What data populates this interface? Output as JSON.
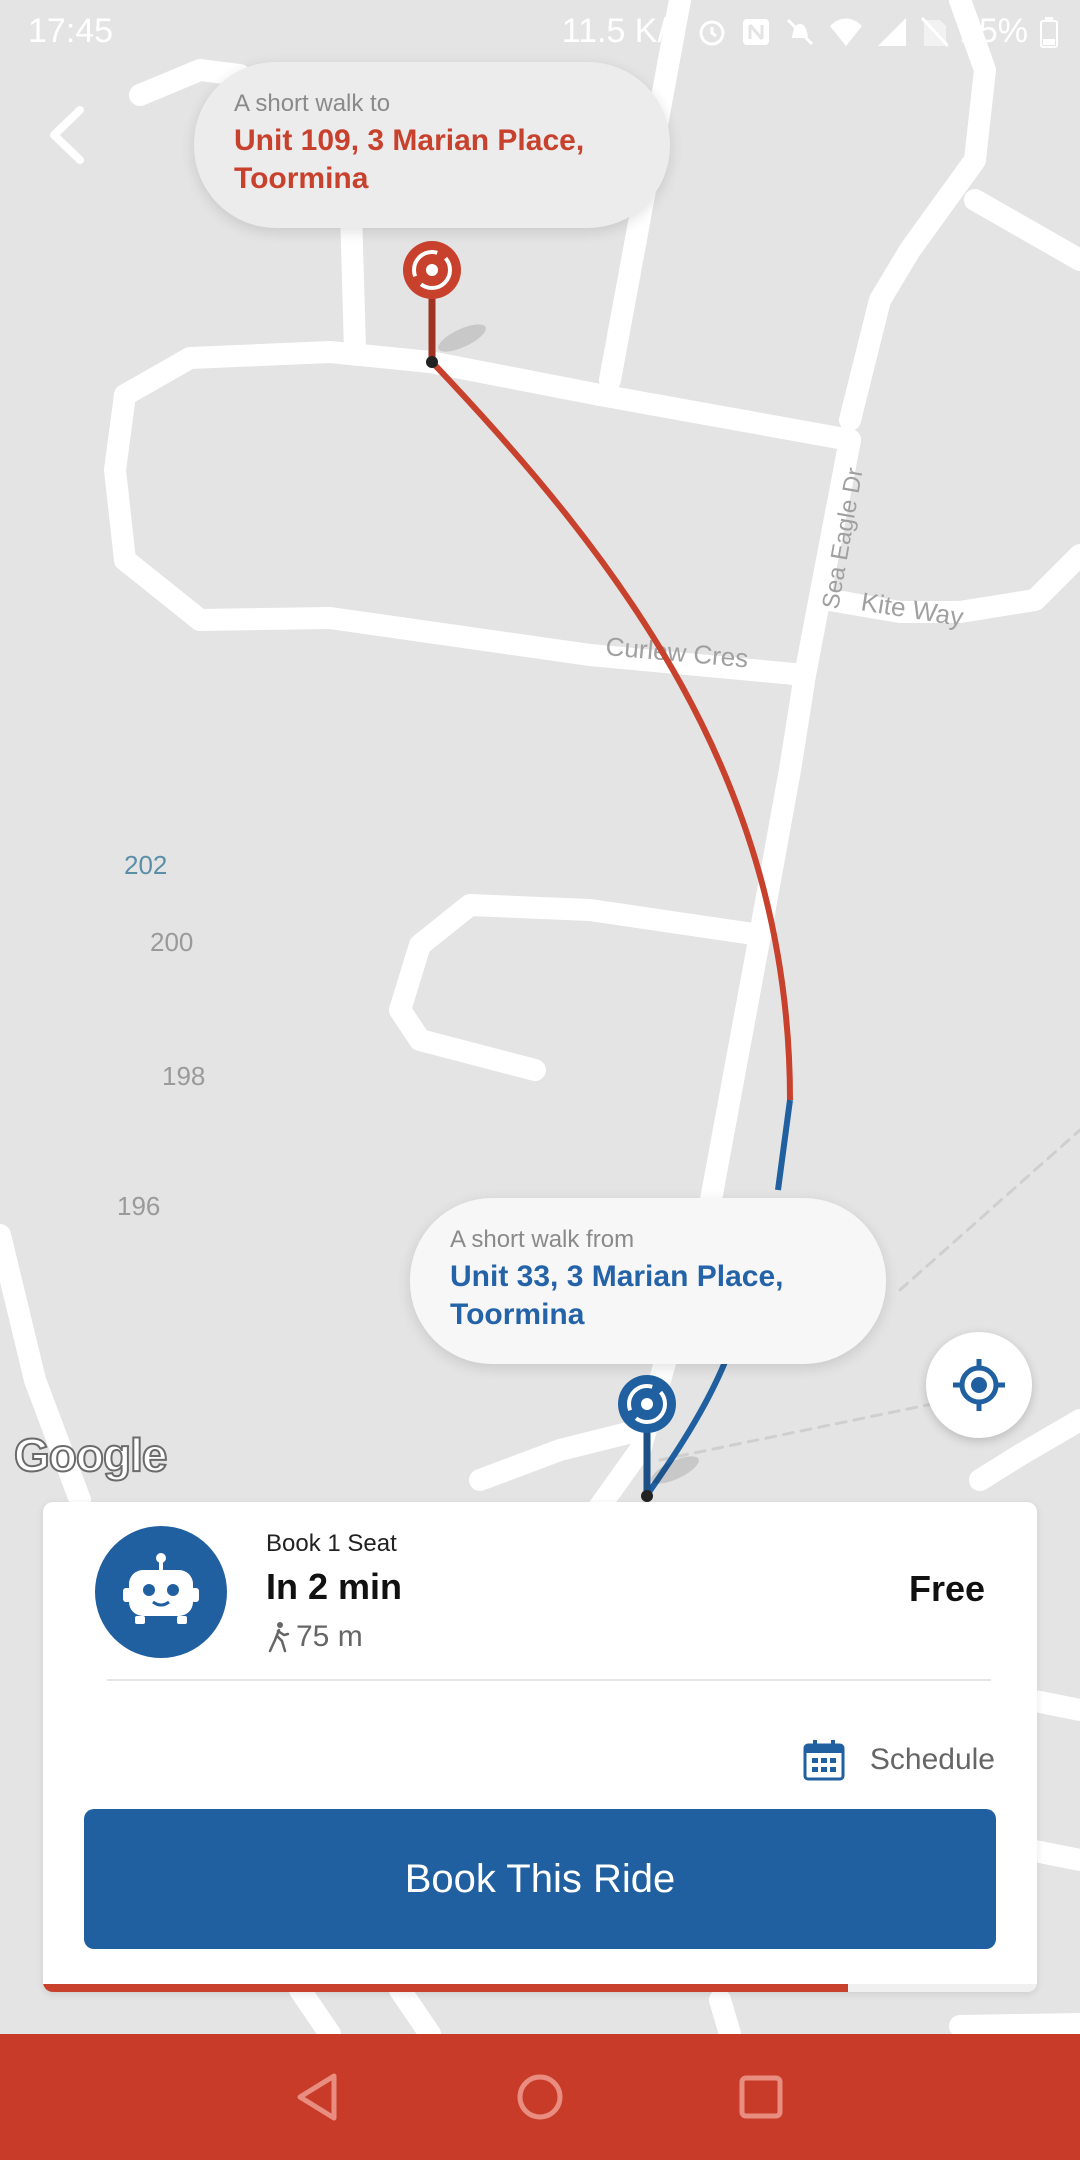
{
  "status_bar": {
    "time": "17:45",
    "speed": "11.5 K/s",
    "battery": "25%",
    "icons": [
      "alarm-icon",
      "nfc-icon",
      "mute-icon",
      "wifi-icon",
      "signal-icon",
      "no-sim-icon",
      "battery-icon"
    ]
  },
  "destination": {
    "subtitle": "A short walk to",
    "address_line1": "Unit 109, 3 Marian Place,",
    "address_line2": "Toormina"
  },
  "origin": {
    "subtitle": "A short walk from",
    "address_line1": "Unit 33, 3 Marian Place,",
    "address_line2": "Toormina"
  },
  "map": {
    "street_labels": [
      "Sea Eagle Dr",
      "Kite Way",
      "Curlew Cres"
    ],
    "house_numbers": [
      "202",
      "200",
      "198",
      "196"
    ],
    "attribution": "Google"
  },
  "ride": {
    "seat_label": "Book 1 Seat",
    "eta": "In 2 min",
    "walk_distance": "75 m",
    "price": "Free",
    "schedule_label": "Schedule",
    "book_button": "Book This Ride",
    "progress": 0.81
  },
  "colors": {
    "accent_red": "#c8412d",
    "accent_blue": "#2160a0",
    "nav_bar": "#c73b28"
  }
}
